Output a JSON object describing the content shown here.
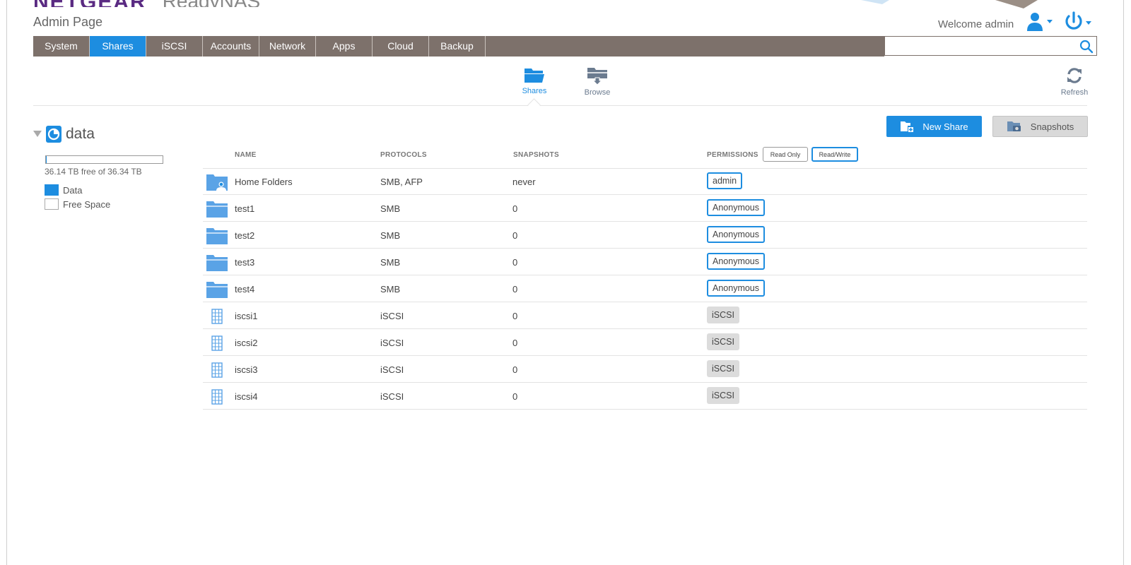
{
  "brand": {
    "logo_text": "NETGEAR",
    "product": "ReadyNAS"
  },
  "page_title": "Admin Page",
  "header": {
    "welcome": "Welcome admin"
  },
  "nav": {
    "tabs": [
      {
        "label": "System"
      },
      {
        "label": "Shares"
      },
      {
        "label": "iSCSI"
      },
      {
        "label": "Accounts"
      },
      {
        "label": "Network"
      },
      {
        "label": "Apps"
      },
      {
        "label": "Cloud"
      },
      {
        "label": "Backup"
      }
    ],
    "active": "Shares"
  },
  "search": {
    "value": "",
    "placeholder": ""
  },
  "subnav": {
    "shares_label": "Shares",
    "browse_label": "Browse",
    "refresh_label": "Refresh"
  },
  "volume": {
    "name": "data",
    "usage_text": "36.14 TB free of 36.34 TB",
    "used_fraction": 0.0055,
    "legend": [
      {
        "label": "Data",
        "color": "#1d8de0"
      },
      {
        "label": "Free Space",
        "color": "#ffffff"
      }
    ]
  },
  "actions": {
    "new_share": "New Share",
    "snapshots": "Snapshots"
  },
  "table": {
    "headers": {
      "name": "NAME",
      "protocols": "PROTOCOLS",
      "snapshots": "SNAPSHOTS",
      "permissions": "PERMISSIONS"
    },
    "perm_toggles": {
      "read_only": "Read Only",
      "read_write": "Read/Write"
    },
    "rows": [
      {
        "icon": "home-folder-icon",
        "name": "Home Folders",
        "protocols": "SMB, AFP",
        "snapshots": "never",
        "permission": "admin",
        "perm_style": "blue"
      },
      {
        "icon": "folder-icon",
        "name": "test1",
        "protocols": "SMB",
        "snapshots": "0",
        "permission": "Anonymous",
        "perm_style": "blue"
      },
      {
        "icon": "folder-icon",
        "name": "test2",
        "protocols": "SMB",
        "snapshots": "0",
        "permission": "Anonymous",
        "perm_style": "blue"
      },
      {
        "icon": "folder-icon",
        "name": "test3",
        "protocols": "SMB",
        "snapshots": "0",
        "permission": "Anonymous",
        "perm_style": "blue"
      },
      {
        "icon": "folder-icon",
        "name": "test4",
        "protocols": "SMB",
        "snapshots": "0",
        "permission": "Anonymous",
        "perm_style": "blue"
      },
      {
        "icon": "lun-icon",
        "name": "iscsi1",
        "protocols": "iSCSI",
        "snapshots": "0",
        "permission": "iSCSI",
        "perm_style": "gray"
      },
      {
        "icon": "lun-icon",
        "name": "iscsi2",
        "protocols": "iSCSI",
        "snapshots": "0",
        "permission": "iSCSI",
        "perm_style": "gray"
      },
      {
        "icon": "lun-icon",
        "name": "iscsi3",
        "protocols": "iSCSI",
        "snapshots": "0",
        "permission": "iSCSI",
        "perm_style": "gray"
      },
      {
        "icon": "lun-icon",
        "name": "iscsi4",
        "protocols": "iSCSI",
        "snapshots": "0",
        "permission": "iSCSI",
        "perm_style": "gray"
      }
    ]
  },
  "colors": {
    "accent": "#1d8de0",
    "navbar": "#7d716b",
    "brand": "#5a2a82"
  }
}
